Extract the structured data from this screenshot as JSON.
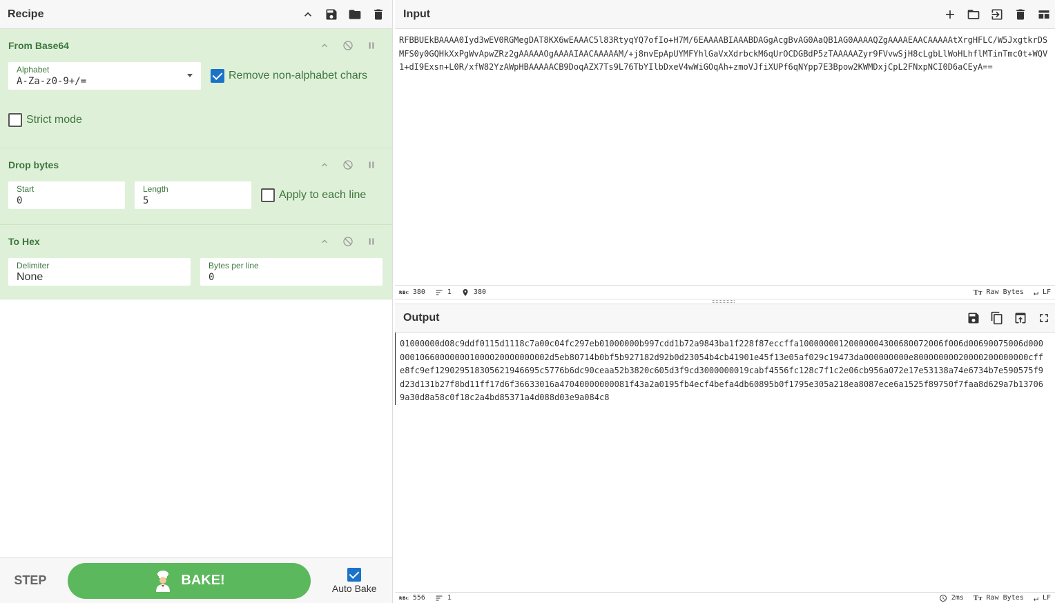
{
  "recipe": {
    "title": "Recipe",
    "operations": [
      {
        "name": "From Base64",
        "alphabet_label": "Alphabet",
        "alphabet_value": "A-Za-z0-9+/=",
        "remove_label": "Remove non-alphabet chars",
        "remove_checked": true,
        "strict_label": "Strict mode",
        "strict_checked": false
      },
      {
        "name": "Drop bytes",
        "start_label": "Start",
        "start_value": "0",
        "length_label": "Length",
        "length_value": "5",
        "apply_label": "Apply to each line",
        "apply_checked": false
      },
      {
        "name": "To Hex",
        "delimiter_label": "Delimiter",
        "delimiter_value": "None",
        "bpl_label": "Bytes per line",
        "bpl_value": "0"
      }
    ]
  },
  "controls": {
    "step_label": "STEP",
    "bake_label": "BAKE!",
    "autobake_label": "Auto Bake",
    "autobake_checked": true
  },
  "input": {
    "title": "Input",
    "text": "RFBBUEkBAAAA0Iyd3wEV0RGMegDAT8KX6wEAAAC5l83RtyqYQ7ofIo+H7M/6EAAAABIAAABDAGgAcgBvAG0AaQB1AG0AAAAQZgAAAAEAACAAAAAtXrgHFLC/W5JxgtkrDSMFS0y0GQHkXxPgWvApwZRz2gAAAAAOgAAAAIAACAAAAAM/+j8nvEpApUYMFYhlGaVxXdrbckM6qUrOCDGBdP5zTAAAAAZyr9FVvwSjH8cLgbLlWoHLhflMTinTmc0t+WQV1+dI9Exsn+L0R/xfW82YzAWpHBAAAAACB9DoqAZX7Ts9L76TbYIlbDxeV4wWiGOqAh+zmoVJfiXUPf6qNYpp7E3Bpow2KWMDxjCpL2FNxpNCI0D6aCEyA==",
    "status_length": "380",
    "status_lines": "1",
    "status_pos": "380",
    "status_encoding": "Raw Bytes",
    "status_eol": "LF"
  },
  "output": {
    "title": "Output",
    "text": "01000000d08c9ddf0115d1118c7a00c04fc297eb01000000b997cdd1b72a9843ba1f228f87eccffa10000000120000004300680072006f006d00690075006d000000106600000001000020000000002d5eb80714b0bf5b927182d92b0d23054b4cb41901e45f13e05af029c19473da000000000e80000000020000200000000cffe8fc9ef129029518305621946695c5776b6dc90ceaa52b3820c605d3f9cd3000000019cabf4556fc128c7f1c2e06cb956a072e17e53138a74e6734b7e590575f9d23d131b27f8bd11ff17d6f36633016a47040000000081f43a2a0195fb4ecf4befa4db60895b0f1795e305a218ea8087ece6a1525f89750f7faa8d629a7b137069a30d8a58c0f18c2a4bd85371a4d088d03e9a084c8",
    "status_length": "556",
    "status_lines": "1",
    "status_time": "2ms",
    "status_encoding": "Raw Bytes",
    "status_eol": "LF"
  },
  "colors": {
    "op_bg": "#dff0d8",
    "op_text": "#3c763d",
    "bake": "#5cb85c",
    "check": "#1a73c8"
  }
}
